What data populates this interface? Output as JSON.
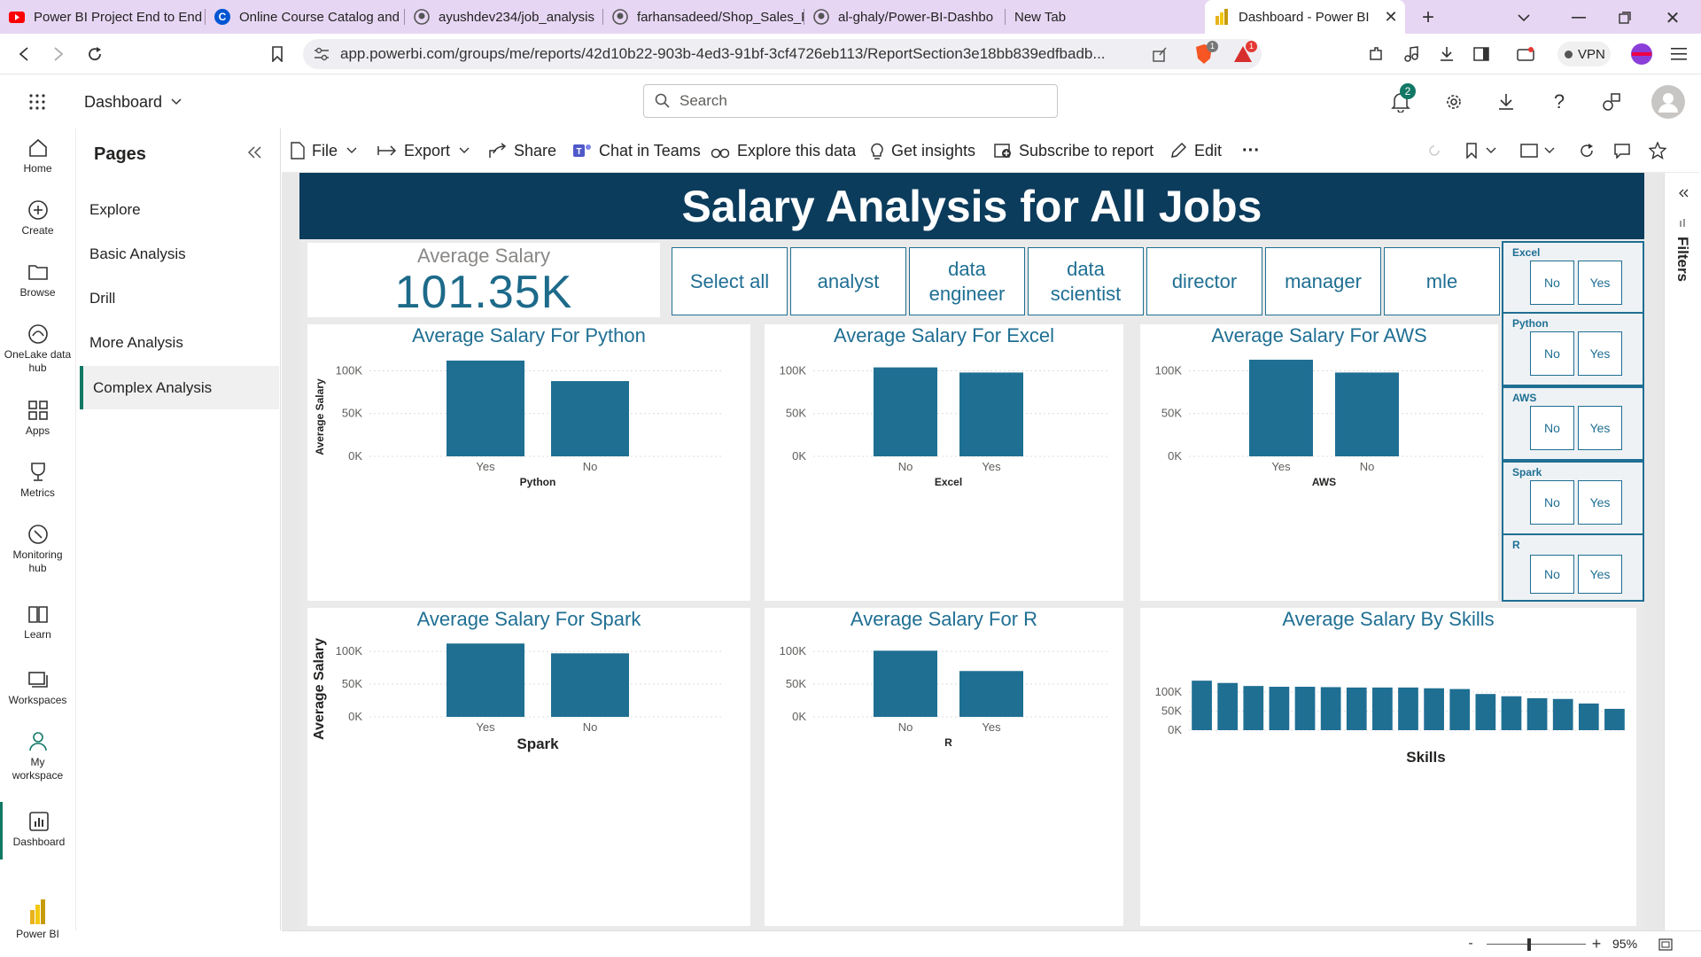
{
  "browser": {
    "tabs": [
      {
        "title": "Power BI Project End to End",
        "icon": "youtube-icon"
      },
      {
        "title": "Online Course Catalog and",
        "icon": "coursera-icon"
      },
      {
        "title": "ayushdev234/job_analysis",
        "icon": "github-icon"
      },
      {
        "title": "farhansadeed/Shop_Sales_P",
        "icon": "github-icon"
      },
      {
        "title": "al-ghaly/Power-BI-Dashbo",
        "icon": "github-icon"
      },
      {
        "title": "New Tab",
        "icon": ""
      },
      {
        "title": "Dashboard - Power BI",
        "icon": "powerbi-icon"
      }
    ],
    "url": "app.powerbi.com/groups/me/reports/42d10b22-903b-4ed3-91bf-3cf4726eb113/ReportSection3e18bb839edfbadb...",
    "vpn_label": "VPN",
    "brave_badge": "1",
    "alert_badge": "1"
  },
  "app": {
    "workspace_label": "Dashboard",
    "search_placeholder": "Search",
    "notification_count": "2"
  },
  "leftnav": {
    "items": [
      {
        "label": "Home",
        "icon": "home-icon"
      },
      {
        "label": "Create",
        "icon": "create-icon"
      },
      {
        "label": "Browse",
        "icon": "browse-icon"
      },
      {
        "label": "OneLake data hub",
        "icon": "onelake-icon"
      },
      {
        "label": "Apps",
        "icon": "apps-icon"
      },
      {
        "label": "Metrics",
        "icon": "metrics-icon"
      },
      {
        "label": "Monitoring hub",
        "icon": "monitoring-icon"
      },
      {
        "label": "Learn",
        "icon": "learn-icon"
      },
      {
        "label": "Workspaces",
        "icon": "workspaces-icon"
      },
      {
        "label": "My workspace",
        "icon": "my-workspace-icon"
      },
      {
        "label": "Dashboard",
        "icon": "dashboard-icon"
      },
      {
        "label": "Power BI",
        "icon": "powerbi-icon"
      }
    ]
  },
  "pages": {
    "heading": "Pages",
    "items": [
      "Explore",
      "Basic Analysis",
      "Drill",
      "More Analysis",
      "Complex Analysis"
    ],
    "selected": "Complex Analysis"
  },
  "toolbar": {
    "file": "File",
    "export": "Export",
    "share": "Share",
    "chat": "Chat in Teams",
    "explore": "Explore this data",
    "insights": "Get insights",
    "subscribe": "Subscribe to report",
    "edit": "Edit",
    "more": "···"
  },
  "report": {
    "title": "Salary Analysis for All Jobs",
    "kpi": {
      "label": "Average Salary",
      "value": "101.35K"
    },
    "job_slicer": [
      "Select all",
      "analyst",
      "data engineer",
      "data scientist",
      "director",
      "manager",
      "mle"
    ],
    "skill_filters": [
      {
        "label": "Excel",
        "options": [
          "No",
          "Yes"
        ]
      },
      {
        "label": "Python",
        "options": [
          "No",
          "Yes"
        ]
      },
      {
        "label": "AWS",
        "options": [
          "No",
          "Yes"
        ]
      },
      {
        "label": "Spark",
        "options": [
          "No",
          "Yes"
        ]
      },
      {
        "label": "R",
        "options": [
          "No",
          "Yes"
        ]
      }
    ],
    "bar_color": "#1f6f93",
    "header_color": "#0c3c5c"
  },
  "chart_data": [
    {
      "type": "bar",
      "title": "Average Salary For Python",
      "xlabel": "Python",
      "ylabel": "Average Salary",
      "categories": [
        "Yes",
        "No"
      ],
      "values": [
        112,
        88
      ],
      "yticks": [
        "100K",
        "50K",
        "0K"
      ],
      "ylim": [
        0,
        115
      ]
    },
    {
      "type": "bar",
      "title": "Average Salary For Excel",
      "xlabel": "Excel",
      "ylabel": "",
      "categories": [
        "No",
        "Yes"
      ],
      "values": [
        104,
        98
      ],
      "yticks": [
        "100K",
        "50K",
        "0K"
      ],
      "ylim": [
        0,
        115
      ]
    },
    {
      "type": "bar",
      "title": "Average Salary For AWS",
      "xlabel": "AWS",
      "ylabel": "",
      "categories": [
        "Yes",
        "No"
      ],
      "values": [
        113,
        98
      ],
      "yticks": [
        "100K",
        "50K",
        "0K"
      ],
      "ylim": [
        0,
        115
      ]
    },
    {
      "type": "bar",
      "title": "Average Salary For Spark",
      "xlabel": "Spark",
      "ylabel": "Average Salary",
      "categories": [
        "Yes",
        "No"
      ],
      "values": [
        112,
        97
      ],
      "yticks": [
        "100K",
        "50K",
        "0K"
      ],
      "ylim": [
        0,
        115
      ]
    },
    {
      "type": "bar",
      "title": "Average Salary For R",
      "xlabel": "R",
      "ylabel": "",
      "categories": [
        "No",
        "Yes"
      ],
      "values": [
        101,
        70
      ],
      "yticks": [
        "100K",
        "50K",
        "0K"
      ],
      "ylim": [
        0,
        115
      ]
    },
    {
      "type": "bar",
      "title": "Average Salary By Skills",
      "xlabel": "Skills",
      "ylabel": "",
      "categories": [],
      "values": [
        130,
        124,
        116,
        114,
        114,
        113,
        112,
        112,
        112,
        110,
        108,
        95,
        89,
        84,
        82,
        70,
        56
      ],
      "yticks": [
        "100K",
        "50K",
        "0K"
      ],
      "ylim": [
        0,
        135
      ]
    }
  ],
  "status": {
    "zoom": "95%"
  }
}
